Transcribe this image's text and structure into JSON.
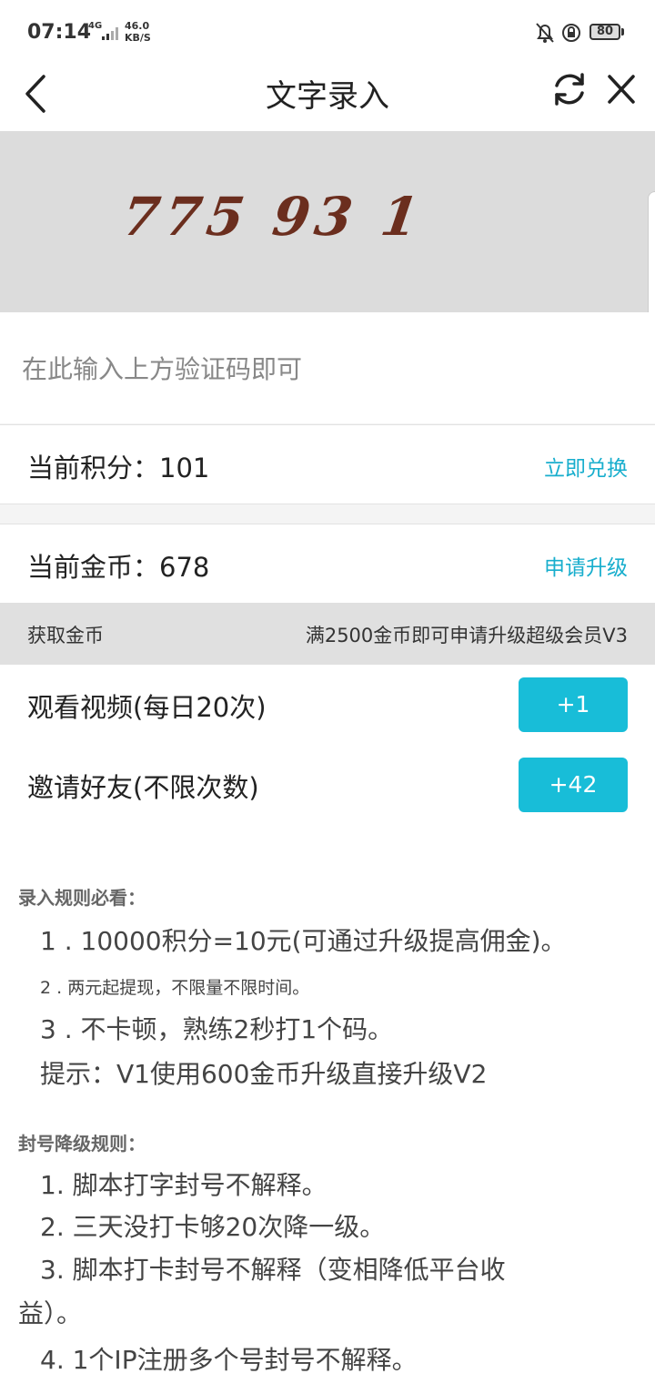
{
  "status_bar": {
    "time": "07:14",
    "network": "4G",
    "speed_value": "46.0",
    "speed_unit": "KB/S",
    "battery": "80"
  },
  "nav": {
    "title": "文字录入",
    "back_icon": "chevron-left-icon",
    "refresh_icon": "refresh-icon",
    "close_icon": "close-icon"
  },
  "captcha": {
    "text": "775 93 1"
  },
  "input": {
    "placeholder": "在此输入上方验证码即可",
    "value": ""
  },
  "points": {
    "label": "当前积分：101",
    "action": "立即兑换"
  },
  "coins": {
    "label": "当前金币：678",
    "action": "申请升级"
  },
  "earn": {
    "title": "获取金币",
    "note": "满2500金币即可申请升级超级会员V3",
    "tasks": [
      {
        "label": "观看视频(每日20次)",
        "button": "+1"
      },
      {
        "label": "邀请好友(不限次数)",
        "button": "+42"
      }
    ]
  },
  "rules": {
    "entry_title": "录入规则必看：",
    "entry_items": [
      "1 . 10000积分=10元(可通过升级提高佣金)。",
      "2 . 两元起提现，不限量不限时间。",
      "3 . 不卡顿，熟练2秒打1个码。",
      "提示：V1使用600金币升级直接升级V2"
    ],
    "ban_title": "封号降级规则：",
    "ban_items": [
      "1. 脚本打字封号不解释。",
      "2. 三天没打卡够20次降一级。",
      "3. 脚本打卡封号不解释（变相降低平台收",
      "益）。",
      "4. 1个IP注册多个号封号不解释。"
    ]
  },
  "colors": {
    "accent": "#18bdd8",
    "link": "#18aecd",
    "captcha_bg": "#dcdcdc",
    "captcha_text": "#6b2e1e"
  }
}
